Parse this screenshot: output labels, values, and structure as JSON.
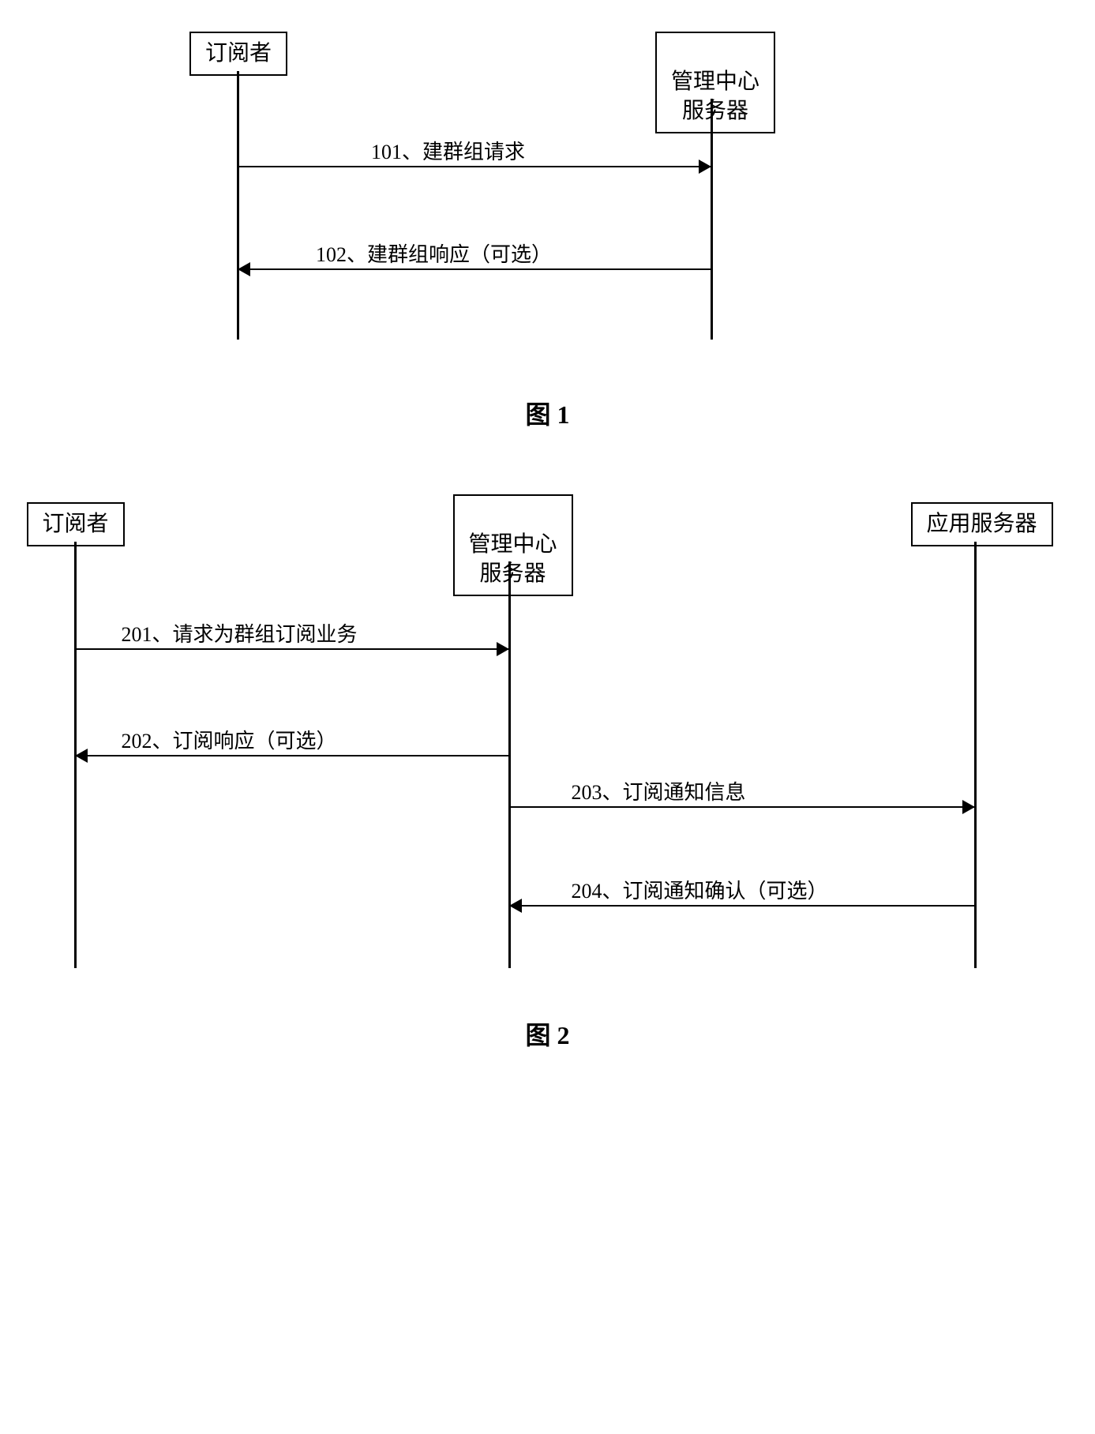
{
  "figure1": {
    "label": "图 1",
    "actors": {
      "subscriber": "订阅者",
      "mgmtCenter": "管理中心\n服务器"
    },
    "messages": {
      "m101": "101、建群组请求",
      "m102": "102、建群组响应（可选）"
    }
  },
  "figure2": {
    "label": "图 2",
    "actors": {
      "subscriber": "订阅者",
      "mgmtCenter": "管理中心\n服务器",
      "appServer": "应用服务器"
    },
    "messages": {
      "m201": "201、请求为群组订阅业务",
      "m202": "202、订阅响应（可选）",
      "m203": "203、订阅通知信息",
      "m204": "204、订阅通知确认（可选）"
    }
  }
}
